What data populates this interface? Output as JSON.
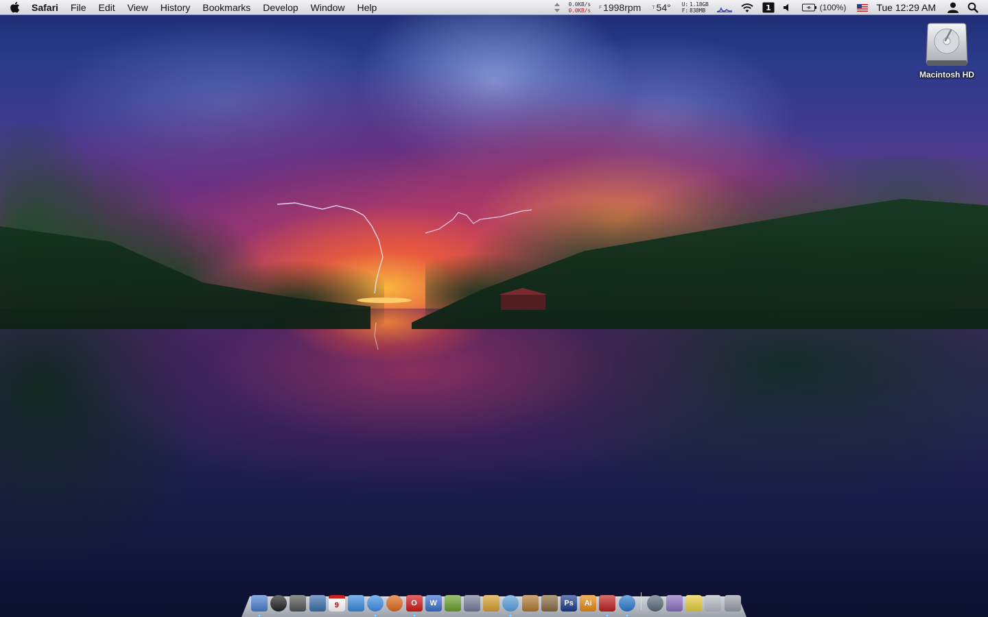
{
  "menubar": {
    "apple_menu": "apple-menu",
    "app_name": "Safari",
    "menus": [
      "File",
      "Edit",
      "View",
      "History",
      "Bookmarks",
      "Develop",
      "Window",
      "Help"
    ]
  },
  "status": {
    "net_up": "0.0KB/s",
    "net_down": "0.0KB/s",
    "fan_label": "F",
    "fan_speed": "1998rpm",
    "temp_label": "T",
    "temperature": "54°",
    "mem_used_label": "U:",
    "mem_used": "1.18GB",
    "mem_free_label": "F:",
    "mem_free": "838MB",
    "battery": "(100%)",
    "clock": "Tue 12:29 AM"
  },
  "desktop": {
    "hd_label": "Macintosh HD"
  },
  "dock": {
    "apps": [
      {
        "name": "finder",
        "glyph": "",
        "bg": "#4a7fd0",
        "running": true
      },
      {
        "name": "dashboard",
        "glyph": "",
        "bg": "#222222",
        "running": false
      },
      {
        "name": "expose",
        "glyph": "",
        "bg": "#555555",
        "running": false
      },
      {
        "name": "preview",
        "glyph": "",
        "bg": "#3a6fb0",
        "running": false
      },
      {
        "name": "ical",
        "glyph": "9",
        "bg": "#ffffff",
        "running": false
      },
      {
        "name": "ichat",
        "glyph": "",
        "bg": "#3a8ae0",
        "running": false
      },
      {
        "name": "safari",
        "glyph": "",
        "bg": "#3e8fe6",
        "running": true
      },
      {
        "name": "firefox",
        "glyph": "",
        "bg": "#e06a1c",
        "running": false
      },
      {
        "name": "opera",
        "glyph": "O",
        "bg": "#d21818",
        "running": true
      },
      {
        "name": "word",
        "glyph": "W",
        "bg": "#3a6fcf",
        "running": false
      },
      {
        "name": "growl",
        "glyph": "",
        "bg": "#6aa030",
        "running": false
      },
      {
        "name": "utility",
        "glyph": "",
        "bg": "#7a7a9a",
        "running": false
      },
      {
        "name": "keynote",
        "glyph": "",
        "bg": "#d9a030",
        "running": false
      },
      {
        "name": "itunes",
        "glyph": "",
        "bg": "#5aa0e0",
        "running": true
      },
      {
        "name": "garageband",
        "glyph": "",
        "bg": "#b07a30",
        "running": false
      },
      {
        "name": "iphoto",
        "glyph": "",
        "bg": "#8a6a40",
        "running": false
      },
      {
        "name": "photoshop",
        "glyph": "Ps",
        "bg": "#1a3a8a",
        "running": false
      },
      {
        "name": "illustrator",
        "glyph": "Ai",
        "bg": "#e88a10",
        "running": false
      },
      {
        "name": "parallels",
        "glyph": "",
        "bg": "#c02020",
        "running": true
      },
      {
        "name": "quicktime",
        "glyph": "",
        "bg": "#2a7ad0",
        "running": true
      }
    ],
    "stacks": [
      {
        "name": "network",
        "glyph": "",
        "bg": "#5a6a7a"
      },
      {
        "name": "applications-stack",
        "glyph": "",
        "bg": "#8a70c0"
      },
      {
        "name": "documents-stack",
        "glyph": "",
        "bg": "#e8d040"
      },
      {
        "name": "downloads-stack",
        "glyph": "",
        "bg": "#b8bcc4"
      },
      {
        "name": "trash",
        "glyph": "",
        "bg": "#9aa0a8"
      }
    ]
  },
  "colors": {
    "menubar_top": "#f4f4f6",
    "menubar_bottom": "#d4d6dc",
    "net_down": "#c0141c"
  }
}
